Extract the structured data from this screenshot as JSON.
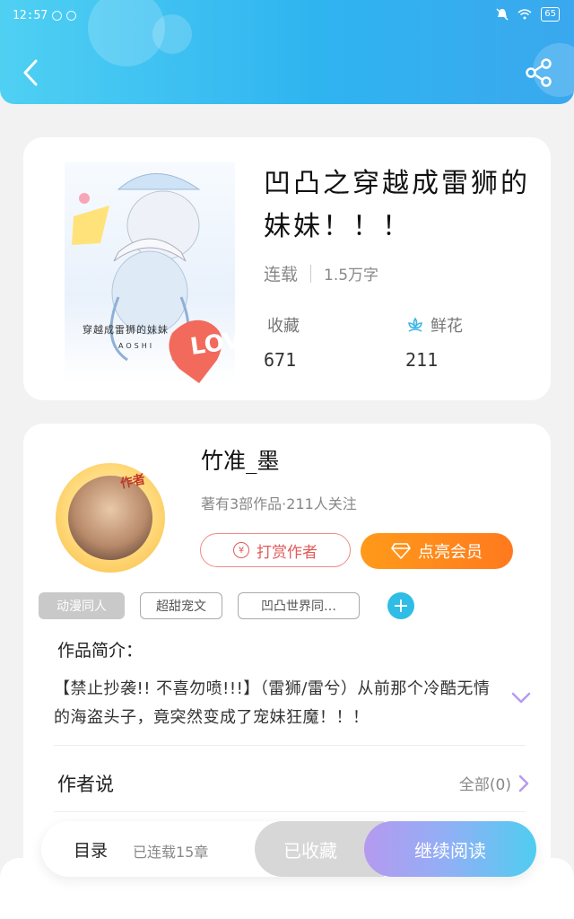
{
  "status": {
    "time": "12:57",
    "battery": "65"
  },
  "book": {
    "title": "凹凸之穿越成雷狮的妹妹！！！",
    "status": "连载",
    "word_count": "1.5万字",
    "favorites_label": "收藏",
    "favorites_value": "671",
    "flowers_label": "鲜花",
    "flowers_value": "211",
    "cover_text": "穿越成雷狮的妹妹",
    "cover_subtext": "AOSHI",
    "cover_love": "LOVE"
  },
  "author": {
    "name": "竹准_墨",
    "info": "著有3部作品·211人关注",
    "badge": "作者",
    "tip_button": "打赏作者",
    "tip_symbol": "¥",
    "vip_button": "点亮会员"
  },
  "tags": [
    "动漫同人",
    "超甜宠文",
    "凹凸世界同…"
  ],
  "intro": {
    "title": "作品简介：",
    "text": "【禁止抄袭!! 不喜勿喷!!!】（雷狮/雷兮）从前那个冷酷无情的海盗头子，竟突然变成了宠妹狂魔！！！"
  },
  "author_say": {
    "title": "作者说",
    "all_label": "全部(0)"
  },
  "bottom": {
    "catalog": "目录",
    "chapters": "已连载15章",
    "collected": "已收藏",
    "continue": "继续阅读"
  },
  "colors": {
    "header": "#2fb4f0",
    "accent_orange": "#ff8a1e",
    "tag_add": "#2fbde5"
  }
}
